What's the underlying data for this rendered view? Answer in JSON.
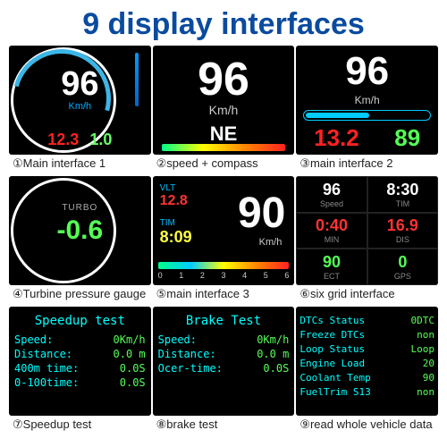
{
  "title": "9 display interfaces",
  "panels": {
    "p1": {
      "speed": "96",
      "unit": "Km/h",
      "val_red": "12.3",
      "val_grn": "1.0",
      "caption": "①Main interface 1"
    },
    "p2": {
      "speed": "96",
      "unit": "Km/h",
      "compass": "NE",
      "caption": "②speed + compass"
    },
    "p3": {
      "speed": "96",
      "unit": "Km/h",
      "val_red": "13.2",
      "val_grn": "89",
      "caption": "③main interface 2"
    },
    "p4": {
      "label": "TURBO",
      "value": "-0.6",
      "caption": "④Turbine pressure gauge"
    },
    "p5": {
      "vlt_label": "VLT",
      "vlt": "12.8",
      "tim_label": "TIM",
      "tim": "8:09",
      "speed": "90",
      "unit": "Km/h",
      "ticks": [
        "0",
        "1",
        "2",
        "3",
        "4",
        "5",
        "6"
      ],
      "caption": "⑤main interface 3"
    },
    "p6": {
      "cells": [
        {
          "v": "96",
          "l": "Speed",
          "cls": "w"
        },
        {
          "v": "8:30",
          "l": "TIM",
          "cls": "w"
        },
        {
          "v": "0:40",
          "l": "MIN",
          "cls": "r"
        },
        {
          "v": "16.9",
          "l": "DIS",
          "cls": "r"
        },
        {
          "v": "90",
          "l": "ECT",
          "cls": "g"
        },
        {
          "v": "0",
          "l": "GPS",
          "cls": "g"
        }
      ],
      "caption": "⑥six grid interface"
    },
    "p7": {
      "header": "Speedup test",
      "rows": [
        {
          "k": "Speed:",
          "v": "0Km/h"
        },
        {
          "k": "Distance:",
          "v": "0.0 m"
        },
        {
          "k": "400m time:",
          "v": "0.0S"
        },
        {
          "k": "0-100time:",
          "v": "0.0S"
        }
      ],
      "caption": "⑦Speedup test"
    },
    "p8": {
      "header": "Brake Test",
      "rows": [
        {
          "k": "Speed:",
          "v": "0Km/h"
        },
        {
          "k": "Distance:",
          "v": "0.0 m"
        },
        {
          "k": "Ocer-time:",
          "v": "0.0S"
        }
      ],
      "caption": "⑧brake test"
    },
    "p9": {
      "rows": [
        {
          "k": "DTCs Status",
          "v": "0DTC"
        },
        {
          "k": "Freeze DTCs",
          "v": "non"
        },
        {
          "k": "Loop Status",
          "v": "Loop"
        },
        {
          "k": "Engine Load",
          "v": "20"
        },
        {
          "k": "Coolant Temp",
          "v": "90"
        },
        {
          "k": "FuelTrim S13",
          "v": "non"
        }
      ],
      "caption": "⑨read whole vehicle data"
    }
  }
}
